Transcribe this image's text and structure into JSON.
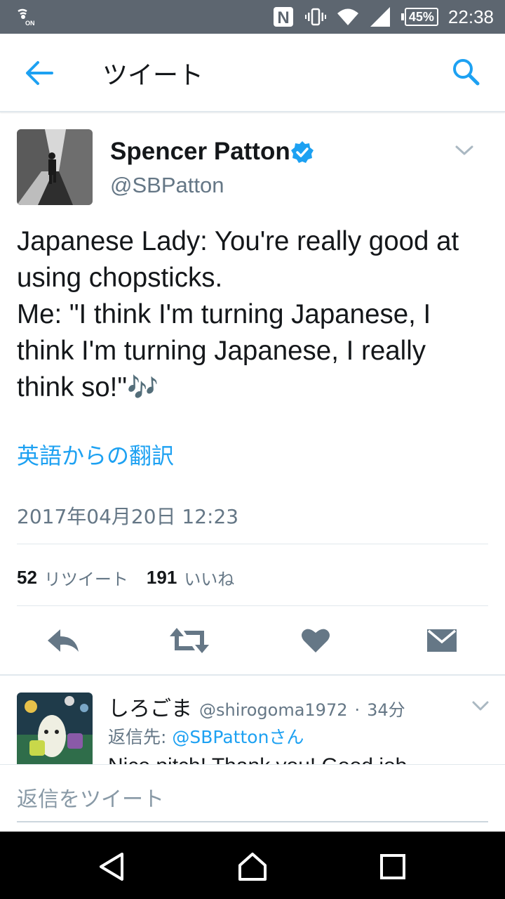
{
  "status_bar": {
    "battery": "45%",
    "time": "22:38",
    "nfc_label": "N",
    "accent": "#5d6670"
  },
  "app_bar": {
    "title": "ツイート",
    "back_icon": "arrow-left-icon",
    "search_icon": "search-icon"
  },
  "tweet": {
    "author_name": "Spencer Patton",
    "author_handle": "@SBPatton",
    "verified": true,
    "text_lines": [
      "Japanese Lady: You're really good at",
      "using chopsticks.",
      "Me: \"I think I'm turning Japanese, I",
      "think I'm turning Japanese, I really",
      "think so!\""
    ],
    "emoji": "🎶",
    "translate_label": "英語からの翻訳",
    "timestamp": "2017年04月20日 12:23",
    "retweet_count": "52",
    "retweet_label": "リツイート",
    "like_count": "191",
    "like_label": "いいね",
    "accent": "#1da1f2"
  },
  "reply": {
    "name": "しろごま",
    "handle": "@shirogoma1972",
    "separator": "·",
    "age": "34分",
    "reply_to_prefix": "返信先: ",
    "reply_to_mention": "@SBPattonさん",
    "text": "Nice pitch! Thank you! Good job"
  },
  "composer": {
    "placeholder": "返信をツイート"
  }
}
